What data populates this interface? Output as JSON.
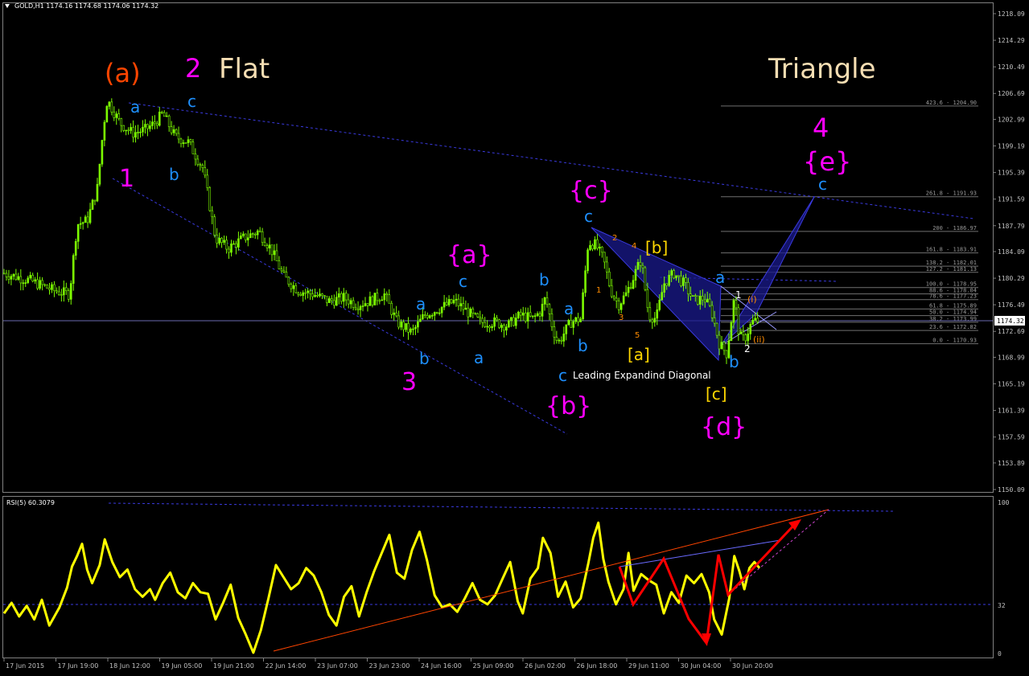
{
  "window": {
    "symbol_header": "GOLD,H1  1174.16 1174.68 1174.06 1174.32",
    "last_price_label": "1174.32"
  },
  "colors": {
    "background": "#000000",
    "candle_up": "#7CFC00",
    "rsi_line": "#FFFF00",
    "wave_magenta": "#FF00FF",
    "wave_cyan": "#1E90FF",
    "wave_orange": "#FF4500",
    "wave_yellow": "#FFD700",
    "title_text": "#F5DEB3",
    "trendline_blue": "#3333CC",
    "pattern_fill": "#1A1A8C",
    "axis_text": "#C0C0C0",
    "fib_line": "#707070",
    "rsi_arrow": "#FF0000",
    "rsi_trend": "#FF4500"
  },
  "chart_data": [
    {
      "type": "line",
      "subtype": "candlestick",
      "symbol": "GOLD",
      "timeframe": "H1",
      "ylim": [
        1150.09,
        1218.09
      ],
      "y_ticks": [
        "1218.09",
        "1214.29",
        "1210.49",
        "1206.69",
        "1202.99",
        "1199.19",
        "1195.39",
        "1191.59",
        "1187.79",
        "1184.09",
        "1180.29",
        "1176.49",
        "1172.69",
        "1168.99",
        "1165.19",
        "1161.39",
        "1157.59",
        "1153.89",
        "1150.09"
      ],
      "x_ticks": [
        "17 Jun 2015",
        "17 Jun 19:00",
        "18 Jun 12:00",
        "19 Jun 05:00",
        "19 Jun 21:00",
        "22 Jun 14:00",
        "23 Jun 07:00",
        "23 Jun 23:00",
        "24 Jun 16:00",
        "25 Jun 09:00",
        "26 Jun 02:00",
        "26 Jun 18:00",
        "29 Jun 11:00",
        "30 Jun 04:00",
        "30 Jun 20:00"
      ],
      "close_price_path": [
        [
          0,
          1181.0
        ],
        [
          1,
          1180.0
        ],
        [
          2,
          1178.5
        ],
        [
          2.6,
          1178.0
        ],
        [
          2.9,
          1188.0
        ],
        [
          3.3,
          1188.5
        ],
        [
          3.7,
          1193.0
        ],
        [
          3.95,
          1202.0
        ],
        [
          4.1,
          1205.8
        ],
        [
          4.6,
          1202.5
        ],
        [
          5.1,
          1201.0
        ],
        [
          5.6,
          1201.5
        ],
        [
          6.0,
          1202.5
        ],
        [
          6.3,
          1203.8
        ],
        [
          6.8,
          1200.5
        ],
        [
          7.3,
          1199.8
        ],
        [
          7.9,
          1196.0
        ],
        [
          8.4,
          1186.0
        ],
        [
          8.9,
          1184.5
        ],
        [
          9.5,
          1186.0
        ],
        [
          10.1,
          1187.0
        ],
        [
          10.6,
          1184.5
        ],
        [
          11.1,
          1180.5
        ],
        [
          11.7,
          1178.5
        ],
        [
          12.3,
          1178.0
        ],
        [
          12.9,
          1177.0
        ],
        [
          13.5,
          1177.5
        ],
        [
          14.0,
          1176.5
        ],
        [
          14.5,
          1177.0
        ],
        [
          15.1,
          1178.0
        ],
        [
          15.6,
          1174.0
        ],
        [
          16.2,
          1172.5
        ],
        [
          16.7,
          1175.0
        ],
        [
          17.3,
          1176.0
        ],
        [
          17.9,
          1177.0
        ],
        [
          18.4,
          1175.5
        ],
        [
          18.9,
          1174.0
        ],
        [
          19.5,
          1174.0
        ],
        [
          20.0,
          1173.5
        ],
        [
          20.5,
          1175.0
        ],
        [
          21.0,
          1174.5
        ],
        [
          21.3,
          1175.5
        ],
        [
          21.5,
          1177.5
        ],
        [
          21.8,
          1173.0
        ],
        [
          22.0,
          1171.0
        ],
        [
          22.5,
          1174.0
        ],
        [
          22.9,
          1174.5
        ],
        [
          23.2,
          1185.5
        ],
        [
          23.5,
          1185.0
        ],
        [
          23.8,
          1183.0
        ],
        [
          24.1,
          1178.5
        ],
        [
          24.4,
          1176.5
        ],
        [
          24.7,
          1178.0
        ],
        [
          25.0,
          1180.5
        ],
        [
          25.3,
          1183.0
        ],
        [
          25.6,
          1175.0
        ],
        [
          25.9,
          1174.5
        ],
        [
          26.2,
          1179.5
        ],
        [
          26.6,
          1181.0
        ],
        [
          27.0,
          1179.5
        ],
        [
          27.4,
          1177.0
        ],
        [
          27.8,
          1177.5
        ],
        [
          28.1,
          1175.5
        ],
        [
          28.4,
          1171.0
        ],
        [
          28.7,
          1169.5
        ],
        [
          29.0,
          1177.5
        ],
        [
          29.2,
          1172.0
        ],
        [
          29.4,
          1171.5
        ],
        [
          29.7,
          1174.0
        ],
        [
          30.0,
          1174.3
        ]
      ]
    },
    {
      "type": "line",
      "title": "RSI(5) 60.3079",
      "ylim": [
        0,
        100
      ],
      "y_ticks": [
        "100",
        "32",
        "0"
      ],
      "level": 32,
      "values": [
        [
          0,
          26
        ],
        [
          0.3,
          33
        ],
        [
          0.6,
          24
        ],
        [
          0.9,
          31
        ],
        [
          1.2,
          22
        ],
        [
          1.5,
          35
        ],
        [
          1.8,
          18
        ],
        [
          2.2,
          30
        ],
        [
          2.5,
          43
        ],
        [
          2.7,
          57
        ],
        [
          2.9,
          64
        ],
        [
          3.1,
          72
        ],
        [
          3.3,
          55
        ],
        [
          3.5,
          46
        ],
        [
          3.8,
          58
        ],
        [
          4.0,
          75
        ],
        [
          4.3,
          60
        ],
        [
          4.6,
          50
        ],
        [
          4.9,
          55
        ],
        [
          5.2,
          42
        ],
        [
          5.5,
          37
        ],
        [
          5.8,
          42
        ],
        [
          6.0,
          35
        ],
        [
          6.3,
          46
        ],
        [
          6.6,
          53
        ],
        [
          6.9,
          40
        ],
        [
          7.2,
          36
        ],
        [
          7.5,
          46
        ],
        [
          7.8,
          40
        ],
        [
          8.1,
          39
        ],
        [
          8.4,
          22
        ],
        [
          8.7,
          33
        ],
        [
          9.0,
          45
        ],
        [
          9.3,
          23
        ],
        [
          9.6,
          12
        ],
        [
          9.9,
          0
        ],
        [
          10.2,
          15
        ],
        [
          10.5,
          36
        ],
        [
          10.8,
          58
        ],
        [
          11.1,
          50
        ],
        [
          11.4,
          42
        ],
        [
          11.7,
          46
        ],
        [
          12.0,
          56
        ],
        [
          12.3,
          51
        ],
        [
          12.6,
          40
        ],
        [
          12.9,
          25
        ],
        [
          13.2,
          18
        ],
        [
          13.5,
          37
        ],
        [
          13.8,
          44
        ],
        [
          14.1,
          24
        ],
        [
          14.4,
          40
        ],
        [
          14.7,
          54
        ],
        [
          15.0,
          66
        ],
        [
          15.3,
          78
        ],
        [
          15.6,
          53
        ],
        [
          15.9,
          49
        ],
        [
          16.2,
          68
        ],
        [
          16.5,
          80
        ],
        [
          16.8,
          61
        ],
        [
          17.1,
          38
        ],
        [
          17.4,
          30
        ],
        [
          17.7,
          32
        ],
        [
          18.0,
          27
        ],
        [
          18.3,
          36
        ],
        [
          18.6,
          46
        ],
        [
          18.9,
          35
        ],
        [
          19.2,
          32
        ],
        [
          19.5,
          38
        ],
        [
          19.8,
          49
        ],
        [
          20.1,
          60
        ],
        [
          20.4,
          34
        ],
        [
          20.6,
          26
        ],
        [
          20.9,
          49
        ],
        [
          21.2,
          56
        ],
        [
          21.4,
          76
        ],
        [
          21.7,
          66
        ],
        [
          22.0,
          37
        ],
        [
          22.3,
          47
        ],
        [
          22.6,
          30
        ],
        [
          22.9,
          36
        ],
        [
          23.2,
          59
        ],
        [
          23.4,
          76
        ],
        [
          23.6,
          86
        ],
        [
          23.8,
          62
        ],
        [
          24.0,
          47
        ],
        [
          24.3,
          32
        ],
        [
          24.6,
          42
        ],
        [
          24.8,
          66
        ],
        [
          25.0,
          41
        ],
        [
          25.3,
          52
        ],
        [
          25.6,
          48
        ],
        [
          25.9,
          45
        ],
        [
          26.2,
          26
        ],
        [
          26.5,
          40
        ],
        [
          26.8,
          33
        ],
        [
          27.1,
          51
        ],
        [
          27.4,
          46
        ],
        [
          27.7,
          52
        ],
        [
          28.0,
          40
        ],
        [
          28.2,
          22
        ],
        [
          28.5,
          12
        ],
        [
          28.8,
          36
        ],
        [
          29.0,
          64
        ],
        [
          29.2,
          54
        ],
        [
          29.4,
          42
        ],
        [
          29.6,
          56
        ],
        [
          29.8,
          60
        ],
        [
          30.0,
          56
        ]
      ]
    }
  ],
  "annotations": {
    "title_flat": "Flat",
    "title_triangle": "Triangle",
    "title_leading": "Leading Expandind Diagonal",
    "w_a_orange": "(a)",
    "w_2": "2",
    "w_1": "1",
    "w_3": "3",
    "w_4": "4",
    "w_e": "{e}",
    "w_c_big": "{c}",
    "w_a_big": "{a}",
    "w_b_big": "{b}",
    "w_d_big": "{d}",
    "y_b": "[b]",
    "y_a": "[a]",
    "y_c": "[c]",
    "c_a1": "a",
    "c_c1": "c",
    "c_b1": "b",
    "c_a2": "a",
    "c_b2": "b",
    "c_a3": "a",
    "c_c3": "c",
    "c_b4": "b",
    "c_a4": "a",
    "c_b5": "b",
    "c_c5": "c",
    "c_c6": "c",
    "c_a7": "a",
    "c_b7": "b",
    "c_c8": "c",
    "o_1": "1",
    "o_2": "2",
    "o_3": "3",
    "o_4": "4",
    "o_5": "5",
    "w_s1": "1",
    "w_s2": "2",
    "o_i": "(i)",
    "o_ii": "(ii)"
  },
  "fibonacci": [
    {
      "label": "423.6 - 1204.90",
      "price": 1204.9
    },
    {
      "label": "261.8 - 1191.93",
      "price": 1191.93
    },
    {
      "label": "200 - 1186.97",
      "price": 1186.97
    },
    {
      "label": "161.8 - 1183.91",
      "price": 1183.91
    },
    {
      "label": "138.2 - 1182.01",
      "price": 1182.01
    },
    {
      "label": "127.2 - 1181.13",
      "price": 1181.13
    },
    {
      "label": "100.0 - 1178.95",
      "price": 1178.95
    },
    {
      "label": "88.6 - 1178.04",
      "price": 1178.04
    },
    {
      "label": "78.6 - 1177.23",
      "price": 1177.23
    },
    {
      "label": "61.8 - 1175.89",
      "price": 1175.89
    },
    {
      "label": "50.0 - 1174.94",
      "price": 1174.94
    },
    {
      "label": "38.2 - 1173.99",
      "price": 1173.99
    },
    {
      "label": "23.6 - 1172.82",
      "price": 1172.82
    },
    {
      "label": "0.0 - 1170.93",
      "price": 1170.93
    }
  ]
}
